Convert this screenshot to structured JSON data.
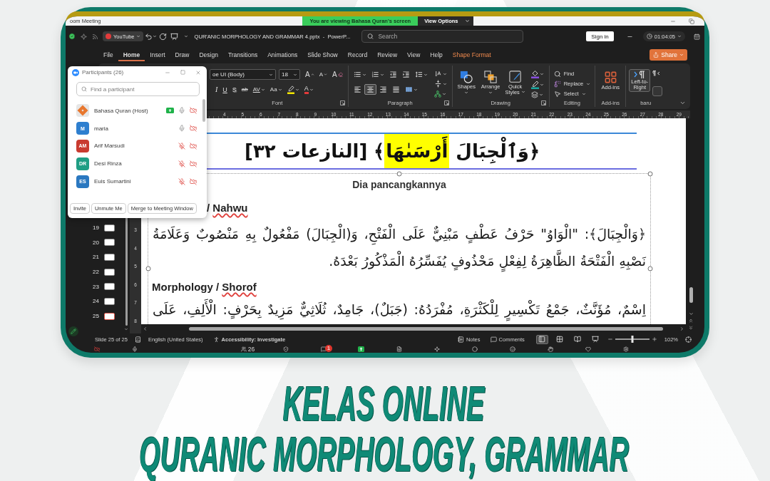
{
  "zoom_bar": {
    "title": "oom Meeting",
    "banner": "You are viewing Bahasa Quran's screen",
    "view_options": "View Options"
  },
  "title_bar": {
    "overlay_tab": "YouTube",
    "document_title": "QUR'ANIC MORPHOLOGY AND GRAMMAR 4.pptx  -  PowerP...",
    "search": {
      "placeholder": "Search"
    },
    "sign_in": "Sign in",
    "timer": "01:04:05"
  },
  "menu": {
    "tabs": [
      {
        "label": "File",
        "selected": false,
        "kind": "standard"
      },
      {
        "label": "Home",
        "selected": true,
        "kind": "standard"
      },
      {
        "label": "Insert",
        "selected": false,
        "kind": "standard"
      },
      {
        "label": "Draw",
        "selected": false,
        "kind": "standard"
      },
      {
        "label": "Design",
        "selected": false,
        "kind": "standard"
      },
      {
        "label": "Transitions",
        "selected": false,
        "kind": "standard"
      },
      {
        "label": "Animations",
        "selected": false,
        "kind": "standard"
      },
      {
        "label": "Slide Show",
        "selected": false,
        "kind": "standard"
      },
      {
        "label": "Record",
        "selected": false,
        "kind": "standard"
      },
      {
        "label": "Review",
        "selected": false,
        "kind": "standard"
      },
      {
        "label": "View",
        "selected": false,
        "kind": "standard"
      },
      {
        "label": "Help",
        "selected": false,
        "kind": "standard"
      },
      {
        "label": "Shape Format",
        "selected": false,
        "kind": "contextual"
      }
    ],
    "share": "Share"
  },
  "ribbon": {
    "font": {
      "name": "oe UI (Body)",
      "size": "18",
      "row_1": [
        {
          "kind": "grow",
          "glyph": "A"
        },
        {
          "kind": "shrink",
          "glyph": "A"
        },
        {
          "kind": "clear",
          "glyph": "A"
        }
      ],
      "row_2": [
        {
          "kind": "italic",
          "glyph": "I"
        },
        {
          "kind": "underline",
          "glyph": "U"
        },
        {
          "kind": "shadow",
          "glyph": "S"
        },
        {
          "kind": "strike",
          "glyph": "ab"
        },
        {
          "kind": "spacing",
          "glyph": "AV"
        },
        {
          "kind": "case",
          "glyph": "Aa"
        },
        {
          "kind": "highlight"
        },
        {
          "kind": "color",
          "glyph": "A"
        }
      ],
      "label": "Font"
    },
    "paragraph": {
      "align": [
        {
          "kind": "left",
          "selected": false
        },
        {
          "kind": "center",
          "selected": true
        },
        {
          "kind": "right",
          "selected": false
        },
        {
          "kind": "justify",
          "selected": false
        }
      ],
      "label": "Paragraph"
    },
    "drawing": {
      "buttons": [
        {
          "kind": "shapes",
          "label": "Shapes"
        },
        {
          "kind": "arrange",
          "label": "Arrange"
        },
        {
          "kind": "quick_styles",
          "label": "Quick Styles"
        }
      ],
      "label": "Drawing"
    },
    "editing": {
      "buttons": [
        {
          "kind": "find",
          "label": "Find"
        },
        {
          "kind": "replace",
          "label": "Replace"
        },
        {
          "kind": "select",
          "label": "Select"
        }
      ],
      "label": "Editing"
    },
    "add_ins": {
      "button": "Add-ins",
      "label": "Add-ins"
    },
    "custom_group": {
      "button": "Left-to-Right",
      "label": "baru"
    }
  },
  "participants": {
    "title": "Participants (26)",
    "search": {
      "placeholder": "Find a participant"
    },
    "people": [
      {
        "name": "Bahasa Quran (Host)",
        "avatar": {
          "kind": "logo"
        },
        "color": "#e8772e",
        "sharing": true,
        "muted": false,
        "video_off": true
      },
      {
        "name": "maria",
        "avatar": {
          "kind": "initials",
          "text": "M"
        },
        "color": "#2e7fcf",
        "sharing": false,
        "muted": false,
        "video_off": true
      },
      {
        "name": "Arif Marsudi",
        "avatar": {
          "kind": "initials",
          "text": "AM"
        },
        "color": "#c93b30",
        "sharing": false,
        "muted": true,
        "video_off": true
      },
      {
        "name": "Desi Rinza",
        "avatar": {
          "kind": "initials",
          "text": "DR"
        },
        "color": "#1f9e84",
        "sharing": false,
        "muted": true,
        "video_off": true
      },
      {
        "name": "Euis Sumartini",
        "avatar": {
          "kind": "initials",
          "text": "ES"
        },
        "color": "#2a78c0",
        "sharing": false,
        "muted": true,
        "video_off": true
      }
    ],
    "buttons": [
      "Invite",
      "Unmute Me",
      "Merge to Meeting Window"
    ]
  },
  "ruler": [
    "4",
    "5",
    "6",
    "7",
    "8",
    "9",
    "10",
    "11",
    "12",
    "13",
    "14",
    "15",
    "16",
    "17",
    "18",
    "19",
    "20",
    "21",
    "22",
    "23",
    "24",
    "25",
    "26",
    "27",
    "28",
    "29"
  ],
  "vertical_ruler": [
    "3",
    "4",
    "5",
    "6",
    "7",
    "8"
  ],
  "thumbnails": [
    {
      "number": "19",
      "selected": false
    },
    {
      "number": "20",
      "selected": false
    },
    {
      "number": "21",
      "selected": false
    },
    {
      "number": "22",
      "selected": false
    },
    {
      "number": "23",
      "selected": false
    },
    {
      "number": "24",
      "selected": false
    },
    {
      "number": "25",
      "selected": true
    }
  ],
  "slide": {
    "title": {
      "before": "﴿وَٱلْجِبَالَ ",
      "highlight": "أَرْسَىٰهَا",
      "after": "﴾ [النازعات ٣٢]"
    },
    "subtitle": "Dia pancangkannya",
    "sections": [
      {
        "heading": [
          {
            "text": "/ ",
            "flagged": false
          },
          {
            "text": "Nahwu",
            "flagged": true
          }
        ],
        "body": "﴿وَالْجِبَالَ﴾: \"الْوَاوُ\" حَرْفُ عَطْفٍ مَبْنِيٌّ عَلَى الْفَتْحِ، وَ(الْجِبَالَ) مَفْعُولٌ بِهِ مَنْصُوبٌ وَعَلَامَةُ نَصْبِهِ الْفَتْحَةُ الظَّاهِرَةُ لِفِعْلٍ مَحْذُوفٍ يُفَسِّرُهُ الْمَذْكُورُ بَعْدَهُ."
      },
      {
        "heading": [
          {
            "text": "Morphology / ",
            "flagged": false
          },
          {
            "text": "Shorof",
            "flagged": true
          }
        ],
        "body": "اِسْمٌ، مُؤَنَّثٌ، جَمْعُ تَكْسِيرٍ لِلْكَثْرَةِ، مُفْرَدُهُ: (جَبَلٌ)، جَامِدٌ، ثُلَاثِيٌّ مَزِيدٌ بِحَرْفٍ: الْأَلِفِ، عَلَى"
      }
    ]
  },
  "status_bar": {
    "slide": "Slide 25 of 25",
    "language": "English (United States)",
    "accessibility": "Accessibility: Investigate",
    "notes": "Notes",
    "comments": "Comments",
    "views": [
      {
        "kind": "normal",
        "selected": true
      },
      {
        "kind": "sorter",
        "selected": false
      },
      {
        "kind": "reading",
        "selected": false
      },
      {
        "kind": "slideshow",
        "selected": false
      }
    ],
    "zoom": {
      "level": 0.5,
      "reading": "102%"
    }
  },
  "meeting_toolbar": {
    "participants_count": "26",
    "chat_badge": "1"
  },
  "headline": [
    "KELAS ONLINE",
    "QURANIC MORPHOLOGY, GRAMMAR"
  ]
}
